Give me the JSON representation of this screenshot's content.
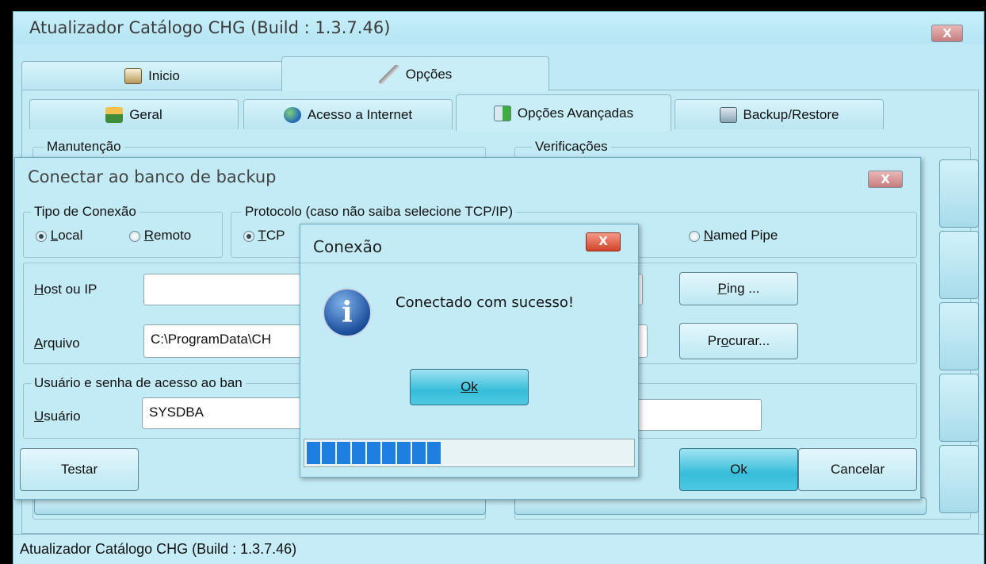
{
  "main_window": {
    "title": "Atualizador Catálogo CHG  (Build : 1.3.7.46)",
    "close_label": "X",
    "top_tabs": [
      {
        "label": "Inicio",
        "icon": "home-icon"
      },
      {
        "label": "Opções",
        "icon": "wrench-icon"
      }
    ],
    "sub_tabs": [
      {
        "label": "Geral",
        "icon": "house-icon"
      },
      {
        "label": "Acesso a Internet",
        "icon": "globe-icon"
      },
      {
        "label": "Opções Avançadas",
        "icon": "arrow-icon"
      },
      {
        "label": "Backup/Restore",
        "icon": "backup-icon"
      }
    ],
    "groups": {
      "maintenance": "Manutenção",
      "checks": "Verificações"
    },
    "status_bar": "Atualizador Catálogo CHG  (Build : 1.3.7.46)"
  },
  "backup_dialog": {
    "title": "Conectar ao banco de backup",
    "close_label": "X",
    "connection_type": {
      "label": "Tipo de Conexão",
      "options": [
        {
          "pre": "",
          "key": "L",
          "post": "ocal",
          "selected": true
        },
        {
          "pre": "",
          "key": "R",
          "post": "emoto",
          "selected": false
        }
      ]
    },
    "protocol": {
      "label": "Protocolo (caso não saiba selecione TCP/IP)",
      "options": [
        {
          "pre": "",
          "key": "T",
          "post": "CP",
          "selected": true
        },
        {
          "pre": "",
          "key": "N",
          "post": "amed Pipe",
          "selected": false
        }
      ]
    },
    "host": {
      "pre": "",
      "key": "H",
      "post": "ost ou IP",
      "value": ""
    },
    "file": {
      "pre": "",
      "key": "A",
      "post": "rquivo",
      "value": "C:\\ProgramData\\CH"
    },
    "ping_button": {
      "pre": "",
      "key": "P",
      "post": "ing ..."
    },
    "browse_button": {
      "pre": "Pr",
      "key": "o",
      "post": "curar..."
    },
    "credentials": {
      "label": "Usuário e senha de acesso ao ban",
      "user": {
        "pre": "",
        "key": "U",
        "post": "suário",
        "value": "SYSDBA"
      }
    },
    "test_button": "Testar",
    "ok_button": "Ok",
    "cancel_button": "Cancelar"
  },
  "message_box": {
    "title": "Conexão",
    "close_label": "X",
    "message": "Conectado com sucesso!",
    "icon": "info-icon",
    "ok_button": "Ok",
    "progress": {
      "filled_blocks": 9,
      "total_blocks": 22
    }
  },
  "colors": {
    "accent": "#36bdd9",
    "progress": "#1f7fe0",
    "background": "#c3ebf6"
  }
}
